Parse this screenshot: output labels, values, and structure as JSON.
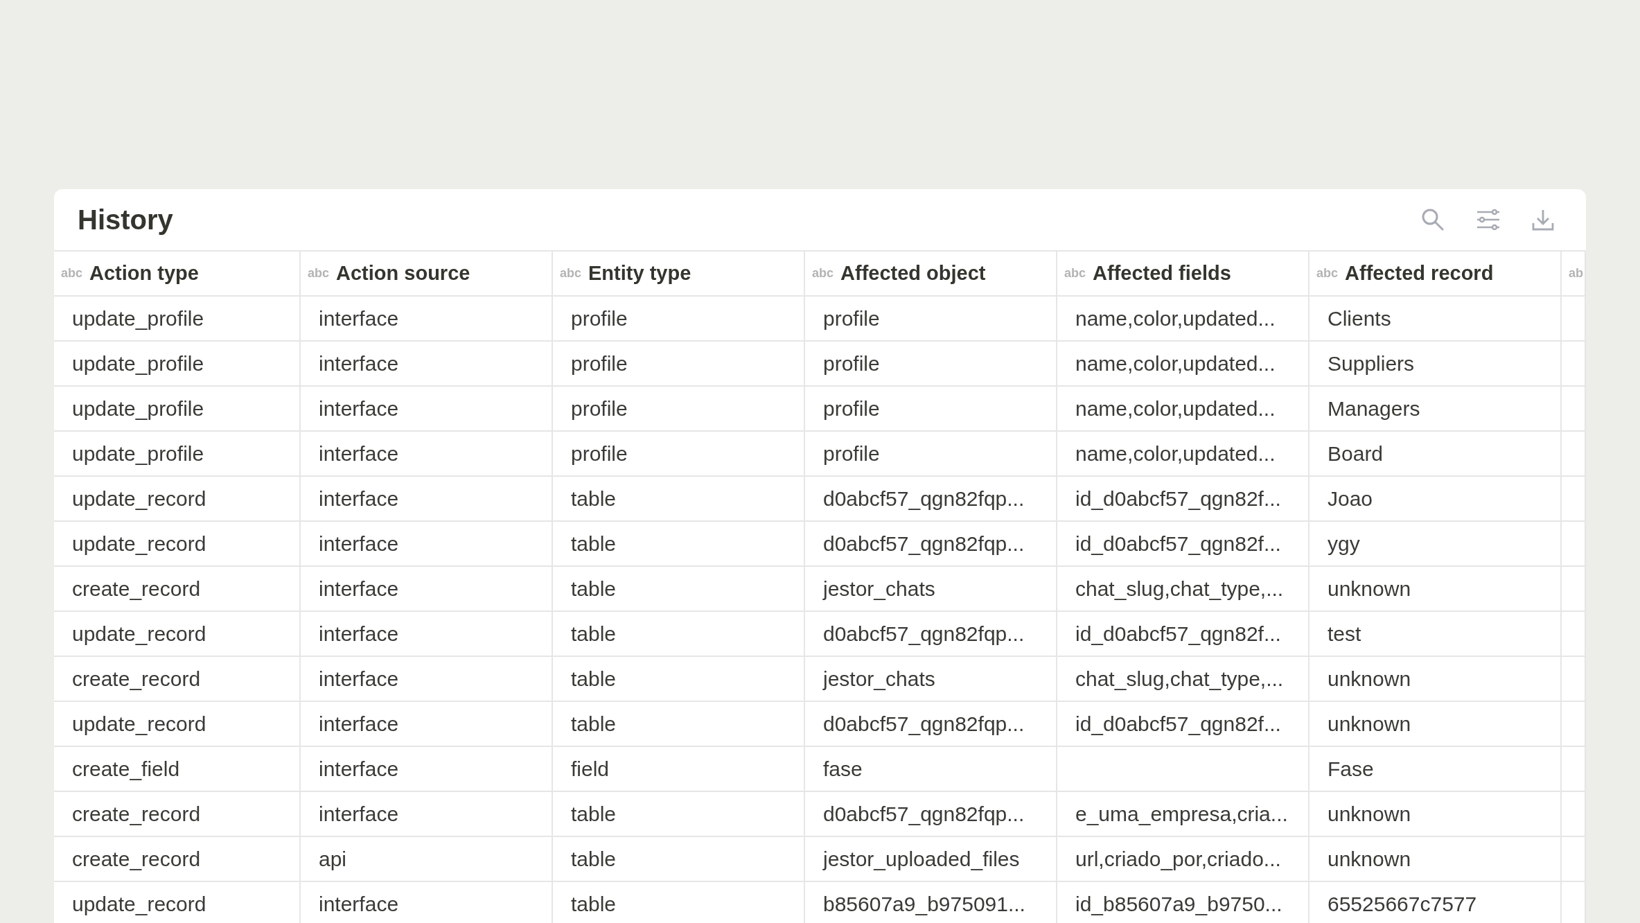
{
  "panel": {
    "title": "History"
  },
  "table": {
    "columns": [
      {
        "type_badge": "abc",
        "label": "Action type"
      },
      {
        "type_badge": "abc",
        "label": "Action source"
      },
      {
        "type_badge": "abc",
        "label": "Entity type"
      },
      {
        "type_badge": "abc",
        "label": "Affected object"
      },
      {
        "type_badge": "abc",
        "label": "Affected fields"
      },
      {
        "type_badge": "abc",
        "label": "Affected record"
      },
      {
        "type_badge": "ab"
      }
    ],
    "rows": [
      [
        "update_profile",
        "interface",
        "profile",
        "profile",
        "name,color,updated...",
        "Clients"
      ],
      [
        "update_profile",
        "interface",
        "profile",
        "profile",
        "name,color,updated...",
        "Suppliers"
      ],
      [
        "update_profile",
        "interface",
        "profile",
        "profile",
        "name,color,updated...",
        "Managers"
      ],
      [
        "update_profile",
        "interface",
        "profile",
        "profile",
        "name,color,updated...",
        "Board"
      ],
      [
        "update_record",
        "interface",
        "table",
        "d0abcf57_qgn82fqp...",
        "id_d0abcf57_qgn82f...",
        "Joao"
      ],
      [
        "update_record",
        "interface",
        "table",
        "d0abcf57_qgn82fqp...",
        "id_d0abcf57_qgn82f...",
        "ygy"
      ],
      [
        "create_record",
        "interface",
        "table",
        "jestor_chats",
        "chat_slug,chat_type,...",
        "unknown"
      ],
      [
        "update_record",
        "interface",
        "table",
        "d0abcf57_qgn82fqp...",
        "id_d0abcf57_qgn82f...",
        "test"
      ],
      [
        "create_record",
        "interface",
        "table",
        "jestor_chats",
        "chat_slug,chat_type,...",
        "unknown"
      ],
      [
        "update_record",
        "interface",
        "table",
        "d0abcf57_qgn82fqp...",
        "id_d0abcf57_qgn82f...",
        "unknown"
      ],
      [
        "create_field",
        "interface",
        "field",
        "fase",
        null,
        "Fase"
      ],
      [
        "create_record",
        "interface",
        "table",
        "d0abcf57_qgn82fqp...",
        "e_uma_empresa,cria...",
        "unknown"
      ],
      [
        "create_record",
        "api",
        "table",
        "jestor_uploaded_files",
        "url,criado_por,criado...",
        "unknown"
      ],
      [
        "update_record",
        "interface",
        "table",
        "b85607a9_b975091...",
        "id_b85607a9_b9750...",
        "65525667c7577"
      ]
    ]
  }
}
